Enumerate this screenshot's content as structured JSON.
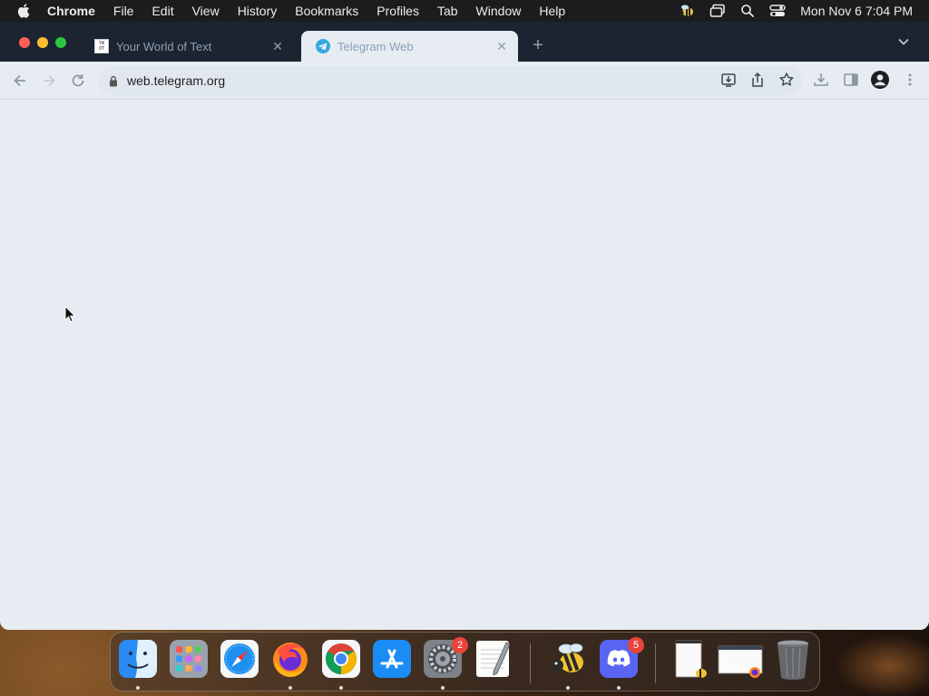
{
  "menubar": {
    "app_name": "Chrome",
    "items": [
      "File",
      "Edit",
      "View",
      "History",
      "Bookmarks",
      "Profiles",
      "Tab",
      "Window",
      "Help"
    ],
    "clock": "Mon Nov 6  7:04 PM"
  },
  "tabs": [
    {
      "title": "Your World of Text",
      "favicon": "your-world-of-text-favicon",
      "active": false
    },
    {
      "title": "Telegram Web",
      "favicon": "telegram-favicon",
      "active": true
    }
  ],
  "toolbar": {
    "url": "web.telegram.org"
  },
  "dock": {
    "items": [
      {
        "name": "finder",
        "running": true
      },
      {
        "name": "launchpad",
        "running": false
      },
      {
        "name": "safari",
        "running": false
      },
      {
        "name": "firefox",
        "running": true
      },
      {
        "name": "chrome",
        "running": true
      },
      {
        "name": "app-store",
        "running": false
      },
      {
        "name": "system-settings",
        "running": true,
        "badge": "2"
      },
      {
        "name": "textedit",
        "running": false
      },
      {
        "name": "bee-app",
        "running": true
      },
      {
        "name": "discord",
        "running": true,
        "badge": "5"
      }
    ]
  },
  "colors": {
    "tabstrip": "#1b2430",
    "page_background": "#e7ecf2",
    "badge": "#e8443a"
  }
}
